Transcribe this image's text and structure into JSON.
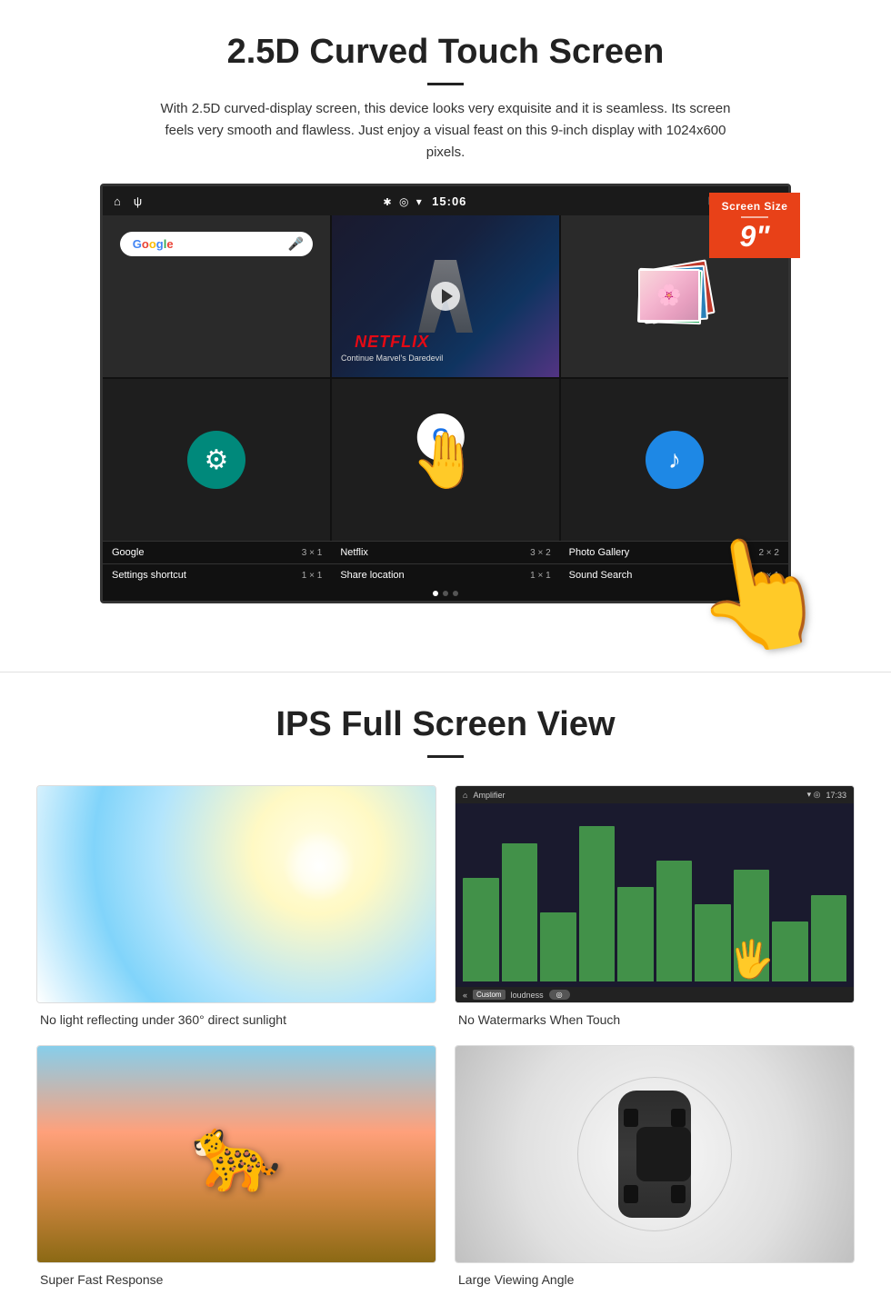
{
  "section1": {
    "title": "2.5D Curved Touch Screen",
    "description": "With 2.5D curved-display screen, this device looks very exquisite and it is seamless. Its screen feels very smooth and flawless. Just enjoy a visual feast on this 9-inch display with 1024x600 pixels.",
    "screen_size_badge": {
      "title": "Screen Size",
      "size": "9\""
    },
    "status_bar": {
      "time": "15:06"
    },
    "apps": [
      {
        "name": "Google",
        "size": "3 × 1"
      },
      {
        "name": "Netflix",
        "size": "3 × 2"
      },
      {
        "name": "Photo Gallery",
        "size": "2 × 2"
      },
      {
        "name": "Settings shortcut",
        "size": "1 × 1"
      },
      {
        "name": "Share location",
        "size": "1 × 1"
      },
      {
        "name": "Sound Search",
        "size": "1 × 1"
      }
    ],
    "netflix": {
      "logo": "NETFLIX",
      "subtitle": "Continue Marvel's Daredevil"
    }
  },
  "section2": {
    "title": "IPS Full Screen View",
    "features": [
      {
        "caption": "No light reflecting under 360° direct sunlight"
      },
      {
        "caption": "No Watermarks When Touch"
      },
      {
        "caption": "Super Fast Response"
      },
      {
        "caption": "Large Viewing Angle"
      }
    ]
  }
}
